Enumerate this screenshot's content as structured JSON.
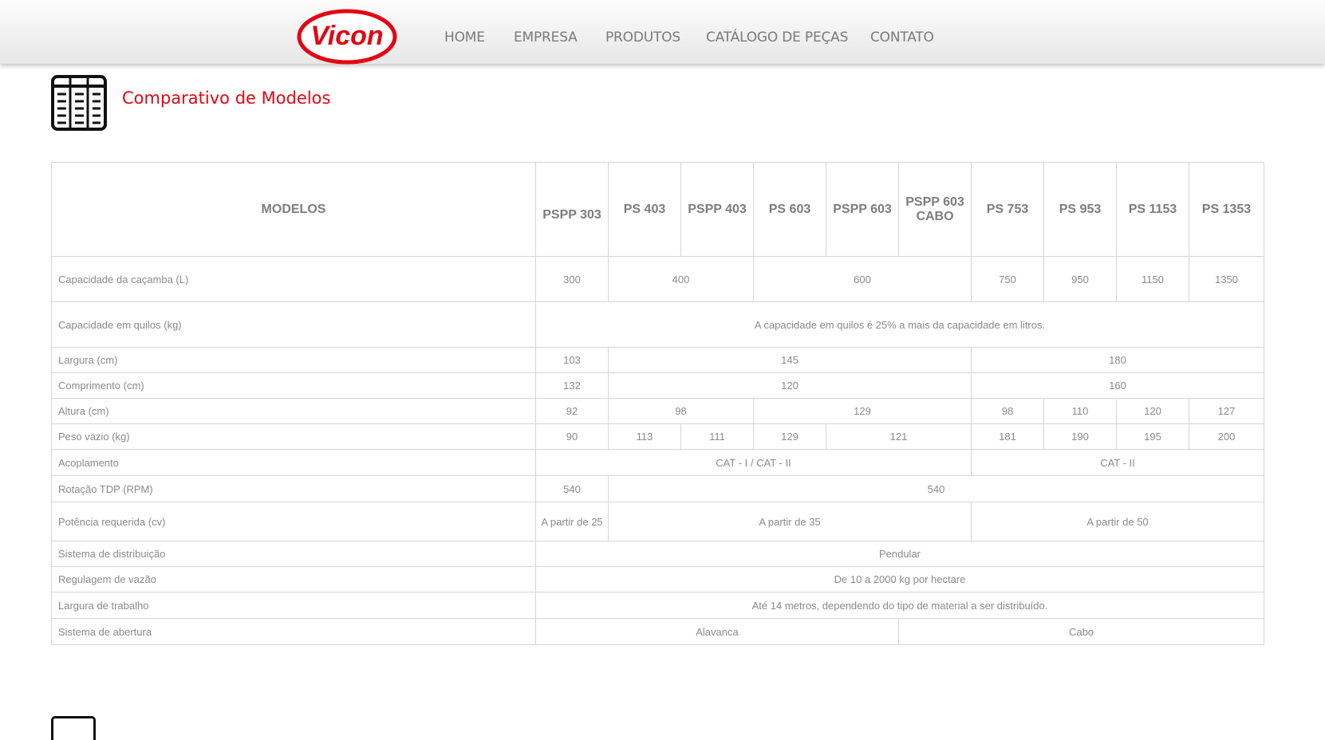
{
  "brand": {
    "logo_text": "Vicon",
    "logo_color": "#e30613"
  },
  "nav": {
    "items": [
      {
        "label": "HOME"
      },
      {
        "label": "EMPRESA"
      },
      {
        "label": "PRODUTOS"
      },
      {
        "label": "CATÁLOGO DE PEÇAS"
      },
      {
        "label": "CONTATO"
      }
    ]
  },
  "section": {
    "title": "Comparativo de Modelos",
    "icon": "table-icon"
  },
  "table": {
    "header": {
      "first": "MODELOS",
      "models": [
        "PSPP 303",
        "PS 403",
        "PSPP 403",
        "PS 603",
        "PSPP 603",
        "PSPP 603 CABO",
        "PS 753",
        "PS 953",
        "PS 1153",
        "PS 1353"
      ]
    },
    "rows": [
      {
        "label": "Capacidade da caçamba (L)",
        "cells": [
          "300",
          "400",
          "600",
          "750",
          "950",
          "1150",
          "1350"
        ]
      },
      {
        "label": "Capacidade em quilos (kg)",
        "cells": [
          "A capacidade em quilos é 25% a mais da capacidade em litros."
        ]
      },
      {
        "label": "Largura (cm)",
        "cells": [
          "103",
          "145",
          "180"
        ]
      },
      {
        "label": "Comprimento (cm)",
        "cells": [
          "132",
          "120",
          "160"
        ]
      },
      {
        "label": "Altura (cm)",
        "cells": [
          "92",
          "98",
          "129",
          "98",
          "110",
          "120",
          "127"
        ]
      },
      {
        "label": "Peso vazio (kg)",
        "cells": [
          "90",
          "113",
          "111",
          "129",
          "121",
          "181",
          "190",
          "195",
          "200"
        ]
      },
      {
        "label": "Acoplamento",
        "cells": [
          "CAT - I / CAT - II",
          "CAT - II"
        ]
      },
      {
        "label": "Rotação TDP (RPM)",
        "cells": [
          "540",
          "540"
        ]
      },
      {
        "label": "Potência requerida (cv)",
        "cells": [
          "A partir de 25",
          "A partir de 35",
          "A partir de 50"
        ]
      },
      {
        "label": "Sistema de distribuição",
        "cells": [
          "Pendular"
        ]
      },
      {
        "label": "Regulagem de vazão",
        "cells": [
          "De 10 a 2000 kg por hectare"
        ]
      },
      {
        "label": "Largura de trabalho",
        "cells": [
          "Até 14 metros, dependendo do tipo de material a ser distribuído."
        ]
      },
      {
        "label": "Sistema de abertura",
        "cells": [
          "Alavanca",
          "Cabo"
        ]
      }
    ]
  }
}
